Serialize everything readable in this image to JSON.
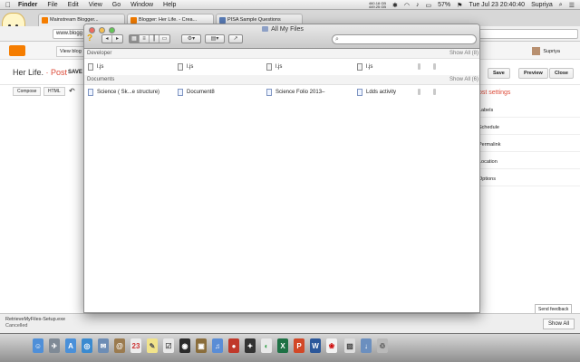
{
  "menubar": {
    "app": "Finder",
    "items": [
      "File",
      "Edit",
      "View",
      "Go",
      "Window",
      "Help"
    ],
    "disk_top": "460.18 GB",
    "disk_bottom": "449.25 GB",
    "battery": "57%",
    "clock": "Tue Jul 23  20:40:40",
    "user": "Supriya"
  },
  "chrome": {
    "tabs": [
      "Mainstream Blogger...",
      "Blogger: Her Life. - Crea...",
      "PISA Sample Questions"
    ],
    "url": "www.blogg"
  },
  "blogger": {
    "view_blog": "View blog",
    "user": "Supriya",
    "title_prefix": "Her Life.",
    "title_sep": " · ",
    "title_accent": "Post",
    "save_draft": "SAVE",
    "buttons": {
      "save": "Save",
      "preview": "Preview",
      "close": "Close"
    },
    "compose": "Compose",
    "html": "HTML",
    "settings_title": "ost settings",
    "settings_items": [
      "Labels",
      "Schedule",
      "Permalink",
      "Location",
      "Options"
    ],
    "feedback": "Send feedback"
  },
  "downloads": {
    "name": "RetrieveMyFiles-Setup.exe",
    "status": "Cancelled",
    "show_all": "Show All"
  },
  "finder": {
    "title": "All My Files",
    "search_placeholder": "",
    "sections": [
      {
        "label": "Developer",
        "show_all": "Show All (8)",
        "files": [
          "l.js",
          "l.js",
          "l.js",
          "l.js"
        ]
      },
      {
        "label": "Documents",
        "show_all": "Show All (6)",
        "files": [
          "Science ( Sk...e structure)",
          "Document8",
          "Science Folio 2013–",
          "Ldds activity"
        ]
      }
    ]
  },
  "dock": {
    "icons": [
      "finder-icon",
      "launchpad-icon",
      "app-store-icon",
      "safari-icon",
      "mail-icon",
      "contacts-icon",
      "calendar-icon",
      "notes-icon",
      "reminders-icon",
      "photo-booth-icon",
      "iphoto-icon",
      "itunes-icon",
      "photo-booth-icon",
      "game-icon",
      "chrome-icon",
      "excel-icon",
      "powerpoint-icon",
      "word-icon",
      "acrobat-icon",
      "preview-icon",
      "downloads-icon",
      "trash-icon"
    ]
  }
}
